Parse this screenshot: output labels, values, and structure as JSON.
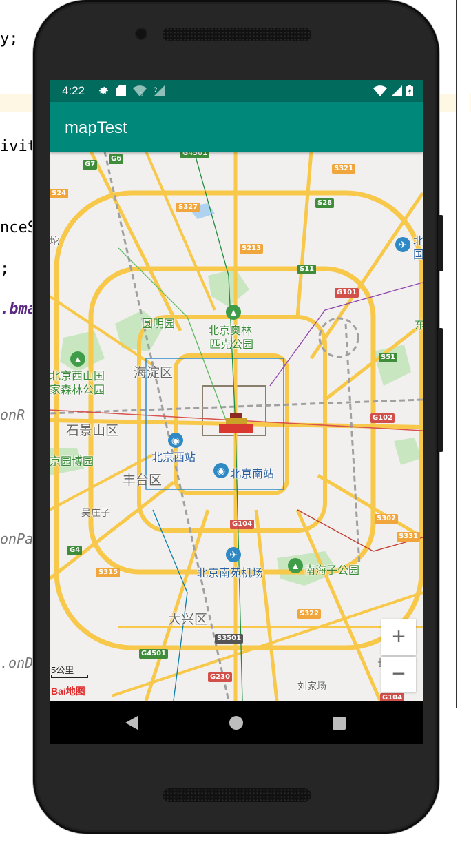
{
  "ide": {
    "lines": [
      {
        "text": "y;"
      },
      {
        "text": "ivit"
      },
      {
        "text": "nceSt"
      },
      {
        "text": ";"
      },
      {
        "text": ".bma"
      },
      {
        "text": "onR"
      },
      {
        "text": "onPa"
      },
      {
        "text": ".onD"
      }
    ]
  },
  "status": {
    "time": "4:22"
  },
  "appbar": {
    "title": "mapTest"
  },
  "map": {
    "places": {
      "yuanmingyuan": "圆明园",
      "olympic_1": "北京奥林",
      "olympic_2": "匹克公园",
      "xishan_1": "北京西山国",
      "xishan_2": "家森林公园",
      "haidian": "海淀区",
      "shijingshan": "石景山区",
      "west_station": "北京西站",
      "south_station": "北京南站",
      "fengtai": "丰台区",
      "garden_expo": "京园博园",
      "wuzhuangzi": "吴庄子",
      "nanyuan_airport": "北京南苑机场",
      "nanhaizi": "南海子公园",
      "daxing": "大兴区",
      "liujiachang": "刘家场",
      "edge_tuo": "坨",
      "edge_bei": "北",
      "edge_guo": "国",
      "edge_dong": "东",
      "edge_chang": "长"
    },
    "shields": [
      "G7",
      "G6",
      "G4501",
      "S321",
      "S24",
      "S327",
      "S28",
      "S213",
      "S11",
      "G101",
      "S51",
      "G102",
      "G104",
      "S302",
      "S331",
      "G4",
      "S315",
      "S322",
      "S3501",
      "G4501",
      "G230",
      "G104"
    ],
    "scale_label": "5公里",
    "logo": "Bai地图",
    "zoom_in": "+",
    "zoom_out": "−"
  }
}
